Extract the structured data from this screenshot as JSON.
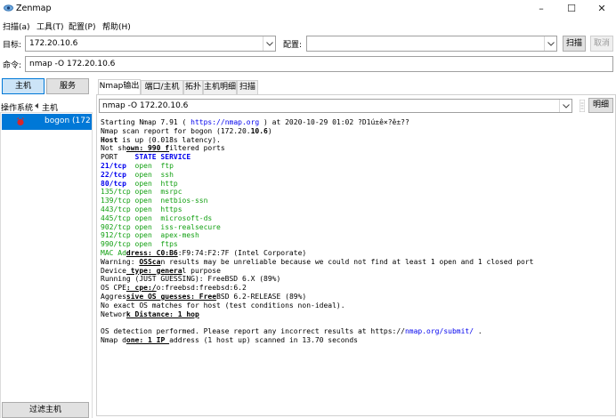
{
  "window": {
    "title": "Zenmap",
    "minimize": "–",
    "maximize": "☐",
    "close": "✕"
  },
  "menu": [
    "扫描(a)",
    "工具(T)",
    "配置(P)",
    "帮助(H)"
  ],
  "target": {
    "label": "目标:",
    "value": "172.20.10.6"
  },
  "profile": {
    "label": "配置:",
    "value": ""
  },
  "scan_button": "扫描",
  "cancel_button": "取消",
  "command": {
    "label": "命令:",
    "value": "nmap -O 172.20.10.6"
  },
  "side_tabs": {
    "hosts": "主机",
    "services": "服务"
  },
  "host_header": {
    "os": "操作系统",
    "host": "主机"
  },
  "hosts": [
    {
      "name": "bogon (172"
    }
  ],
  "filter_button": "过滤主机",
  "tabs": [
    "Nmap输出",
    "端口/主机",
    "拓扑",
    "主机明细",
    "扫描"
  ],
  "output_combo": "nmap -O 172.20.10.6",
  "details_button": "明细",
  "output": [
    [
      {
        "t": "Starting Nmap 7.91 ( "
      },
      {
        "t": "https://nmap.org",
        "c": "blue"
      },
      {
        "t": " ) at 2020-10-29 01:02 ?D1ú±ê×?ê±??"
      }
    ],
    [
      {
        "t": "Nmap scan report for bogon (172.20."
      },
      {
        "t": "10.6",
        "c": "bold"
      },
      {
        "t": ")"
      }
    ],
    [
      {
        "t": "Host",
        "c": "bold"
      },
      {
        "t": " is up (0.018s latency)."
      }
    ],
    [
      {
        "t": "Not sh"
      },
      {
        "t": "own: 990 f",
        "c": "ul"
      },
      {
        "t": "iltered ports"
      }
    ],
    [
      {
        "t": "PORT    "
      },
      {
        "t": "STATE SERVICE",
        "c": "blue bold"
      }
    ],
    [
      {
        "t": "21/tcp",
        "c": "blue bold"
      },
      {
        "t": "  open  ftp",
        "c": "green"
      }
    ],
    [
      {
        "t": "22/tcp",
        "c": "blue bold"
      },
      {
        "t": "  open  ssh",
        "c": "green"
      }
    ],
    [
      {
        "t": "80/tcp",
        "c": "blue bold"
      },
      {
        "t": "  open  http",
        "c": "green"
      }
    ],
    [
      {
        "t": "135/tcp open  msrpc",
        "c": "green"
      }
    ],
    [
      {
        "t": "139/tcp open  netbios-ssn",
        "c": "green"
      }
    ],
    [
      {
        "t": "443/tcp open  https",
        "c": "green"
      }
    ],
    [
      {
        "t": "445/tcp open  microsoft-ds",
        "c": "green"
      }
    ],
    [
      {
        "t": "902/tcp open  iss-realsecure",
        "c": "green"
      }
    ],
    [
      {
        "t": "912/tcp open  apex-mesh",
        "c": "green"
      }
    ],
    [
      {
        "t": "990/tcp open  ftps",
        "c": "green"
      }
    ],
    [
      {
        "t": "MAC Ad",
        "c": "green"
      },
      {
        "t": "dress: C0:B6",
        "c": "ul"
      },
      {
        "t": ":F9:74:F2:7F (Intel Corporate)"
      }
    ],
    [
      {
        "t": "Warning: "
      },
      {
        "t": "OSSca",
        "c": "ul"
      },
      {
        "t": "n results may be unreliable because we could not find at least 1 open and 1 closed port"
      }
    ],
    [
      {
        "t": "Device"
      },
      {
        "t": " type: genera",
        "c": "ul"
      },
      {
        "t": "l purpose"
      }
    ],
    [
      {
        "t": "Running (JUST GUESSING): FreeBSD 6.X (89%)"
      }
    ],
    [
      {
        "t": "OS CPE"
      },
      {
        "t": ": cpe:/",
        "c": "ul"
      },
      {
        "t": "o:freebsd:freebsd:6.2"
      }
    ],
    [
      {
        "t": "Aggres"
      },
      {
        "t": "sive OS guesses: Free",
        "c": "ul"
      },
      {
        "t": "BSD 6.2-RELEASE (89%)"
      }
    ],
    [
      {
        "t": "No exact OS matches for host (test conditions non-ideal)."
      }
    ],
    [
      {
        "t": "Networ"
      },
      {
        "t": "k Distance: 1 hop",
        "c": "ul"
      }
    ],
    [
      {
        "t": ""
      }
    ],
    [
      {
        "t": "OS detection performed. Please report any incorrect results at https://"
      },
      {
        "t": "nmap.org/submit/",
        "c": "blue"
      },
      {
        "t": " ."
      }
    ],
    [
      {
        "t": "Nmap d"
      },
      {
        "t": "one: 1 IP ",
        "c": "ul"
      },
      {
        "t": "address (1 host up) scanned in 13.70 seconds"
      }
    ]
  ]
}
